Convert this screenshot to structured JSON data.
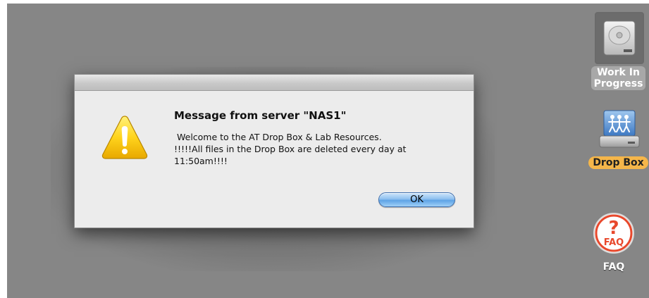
{
  "dialog": {
    "title": "Message from server \"NAS1\"",
    "message_lines": [
      "Welcome to the AT Drop Box & Lab Resources.",
      "!!!!!All files in the Drop Box are deleted every day at",
      "11:50am!!!!"
    ],
    "ok_label": "OK",
    "icon": "warning-icon"
  },
  "desktop": {
    "icons": [
      {
        "label_line1": "Work In",
        "label_line2": "Progress",
        "icon": "hard-drive-icon"
      },
      {
        "label": "Drop Box",
        "icon": "shared-folder-icon"
      },
      {
        "label": "FAQ",
        "icon": "faq-icon"
      }
    ]
  },
  "colors": {
    "desktop_background": "#868686",
    "dropbox_label_highlight": "#f5b64a",
    "ok_button_blue": "#5ea3e6",
    "warning_yellow": "#f5c400"
  }
}
